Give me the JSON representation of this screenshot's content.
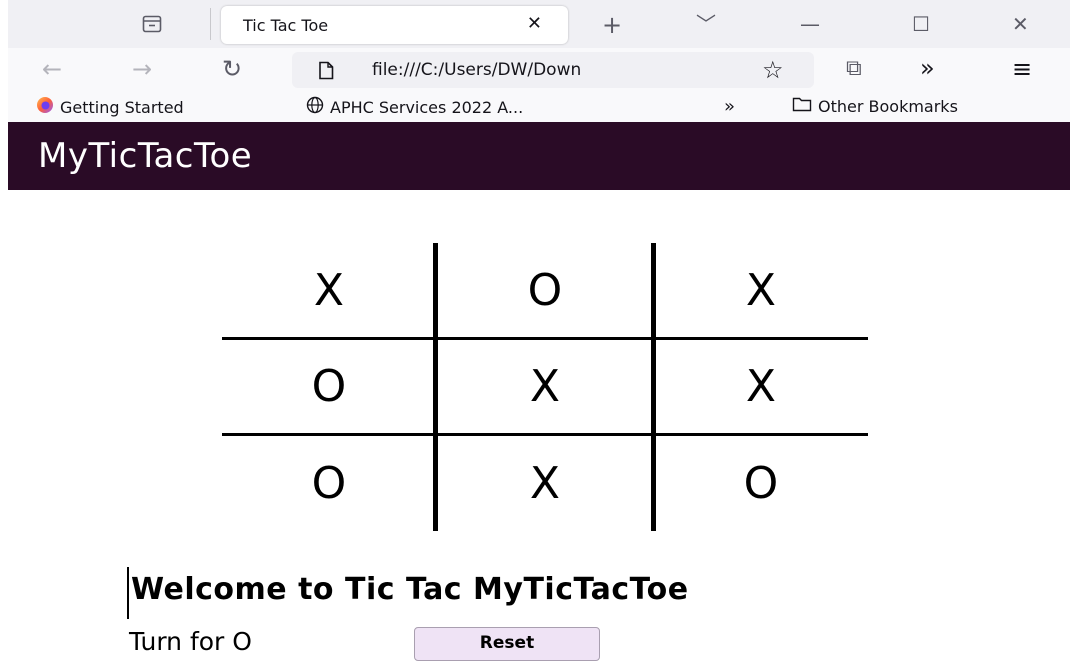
{
  "browser": {
    "tab": {
      "title": "Tic Tac Toe",
      "close_glyph": "✕"
    },
    "new_tab_glyph": "+",
    "list_all_tabs_glyph": "﹀",
    "window_controls": {
      "minimize": "—",
      "maximize": "☐",
      "close": "✕"
    },
    "nav": {
      "back": "←",
      "forward": "→",
      "reload": "↻",
      "extensions": "⧉",
      "overflow": "»",
      "menu": "≡"
    },
    "url": "file:///C:/Users/DW/Down",
    "bookmark_star": "☆",
    "bookmarks": [
      {
        "label": "Getting Started",
        "icon": "firefox-icon"
      },
      {
        "label": "APHC Services 2022 A...",
        "icon": "globe-icon"
      }
    ],
    "bookmarks_overflow": "»",
    "other_bookmarks": "Other Bookmarks",
    "colors": {
      "tabbar": "#f0f0f4",
      "navbar": "#f9f9fb"
    }
  },
  "app": {
    "title": "MyTicTacToe",
    "header_color": "#2a0b26",
    "board": [
      [
        "X",
        "O",
        "X"
      ],
      [
        "O",
        "X",
        "X"
      ],
      [
        "O",
        "X",
        "O"
      ]
    ],
    "welcome": "Welcome to Tic Tac MyTicTacToe",
    "turn": "Turn for O",
    "reset_label": "Reset",
    "reset_color": "#efe3f5"
  }
}
